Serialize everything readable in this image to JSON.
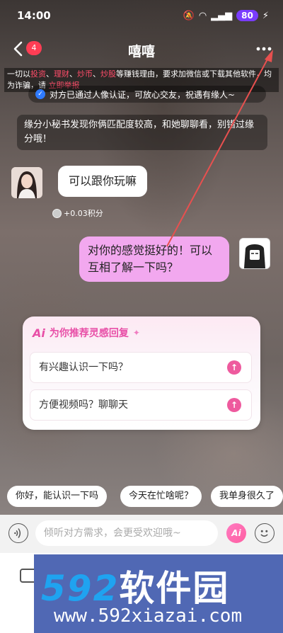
{
  "status": {
    "time": "14:00",
    "battery": "80"
  },
  "header": {
    "back_badge": "4",
    "title": "嘻嘻"
  },
  "warning": {
    "p1": "一切以",
    "k1": "投资",
    "s1": "、",
    "k2": "理财",
    "s2": "、",
    "k3": "炒币",
    "s3": "、",
    "k4": "炒股",
    "p2": "等赚钱理由，要求加微信或下载其他软件，均为诈骗，请 ",
    "link": "立即举报"
  },
  "verify": {
    "text": "对方已通过人像认证，可放心交友，祝遇有缘人~"
  },
  "notice": {
    "text": "缘分小秘书发现你俩匹配度较高，和她聊聊看，别错过缘分哦！"
  },
  "messages": {
    "left_text": "可以跟你玩嘛",
    "points": "+0.03积分",
    "right_text": "对你的感觉挺好的！可以互相了解一下吗？"
  },
  "ai_panel": {
    "logo": "Ai",
    "title": "为你推荐灵感回复",
    "items": [
      "有兴趣认识一下吗？",
      "方便视频吗？聊聊天"
    ]
  },
  "quick_replies": [
    "你好，能认识一下吗",
    "今天在忙啥呢？",
    "我单身很久了"
  ],
  "input": {
    "placeholder": "倾听对方需求，会更受欢迎哦~",
    "ai_label": "Ai"
  },
  "watermark": {
    "logo_num": "592",
    "logo_text": "软件园",
    "url": "www.592xiazai.com"
  },
  "colors": {
    "accent_pink": "#ee5a9e",
    "bubble_pink": "#f2a8ef",
    "battery": "#7a3cff",
    "badge_red": "#ff3d54"
  }
}
